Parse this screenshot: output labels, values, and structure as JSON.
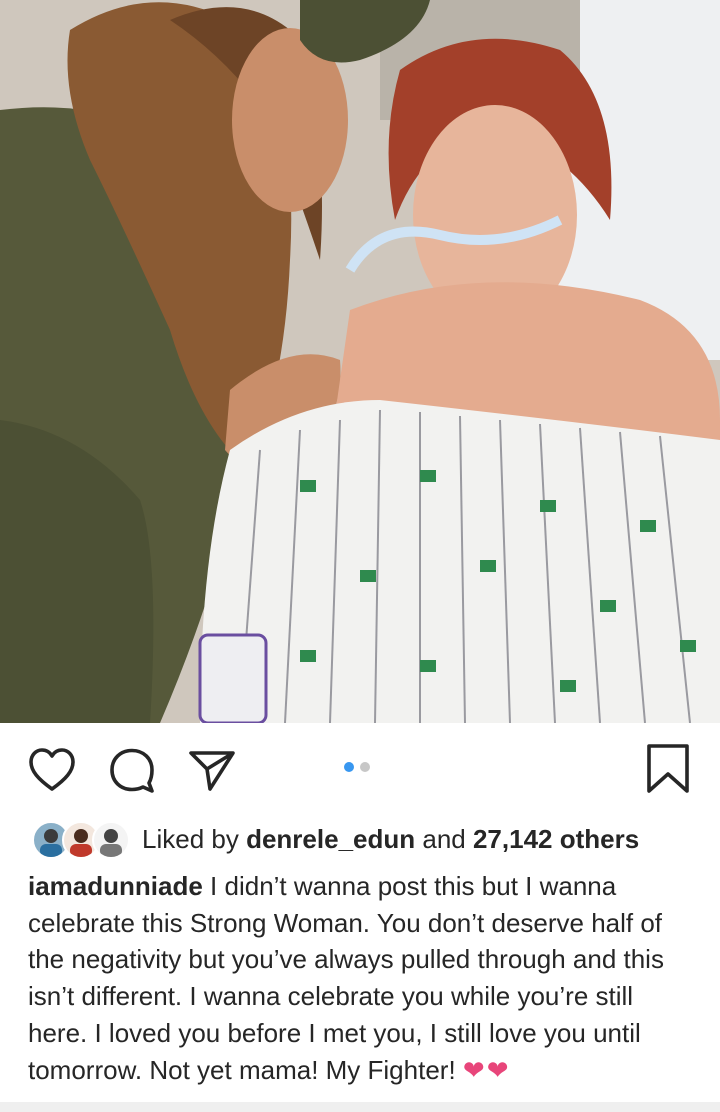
{
  "post": {
    "username": "iamadunniade",
    "caption_text": " I didn’t wanna post this but I wanna celebrate this Strong Woman. You don’t deserve half of the negativity but you’ve always pulled through and this isn’t different. I wanna celebrate you while you’re still here. I loved you before I met you, I still love you until tomorrow. Not yet mama! My Fighter!",
    "caption_emoji": "❤❤"
  },
  "likes": {
    "prefix": "Liked by ",
    "first_liker": "denrele_edun",
    "middle": " and ",
    "count_text": "27,142 others"
  },
  "carousel": {
    "total": 2,
    "active_index": 0
  },
  "icons": {
    "like": "heart-outline-icon",
    "comment": "comment-bubble-icon",
    "share": "paper-plane-icon",
    "save": "bookmark-icon"
  },
  "colors": {
    "accent_blue": "#3897f0",
    "text": "#262626",
    "emoji_heart": "#e8457a"
  }
}
